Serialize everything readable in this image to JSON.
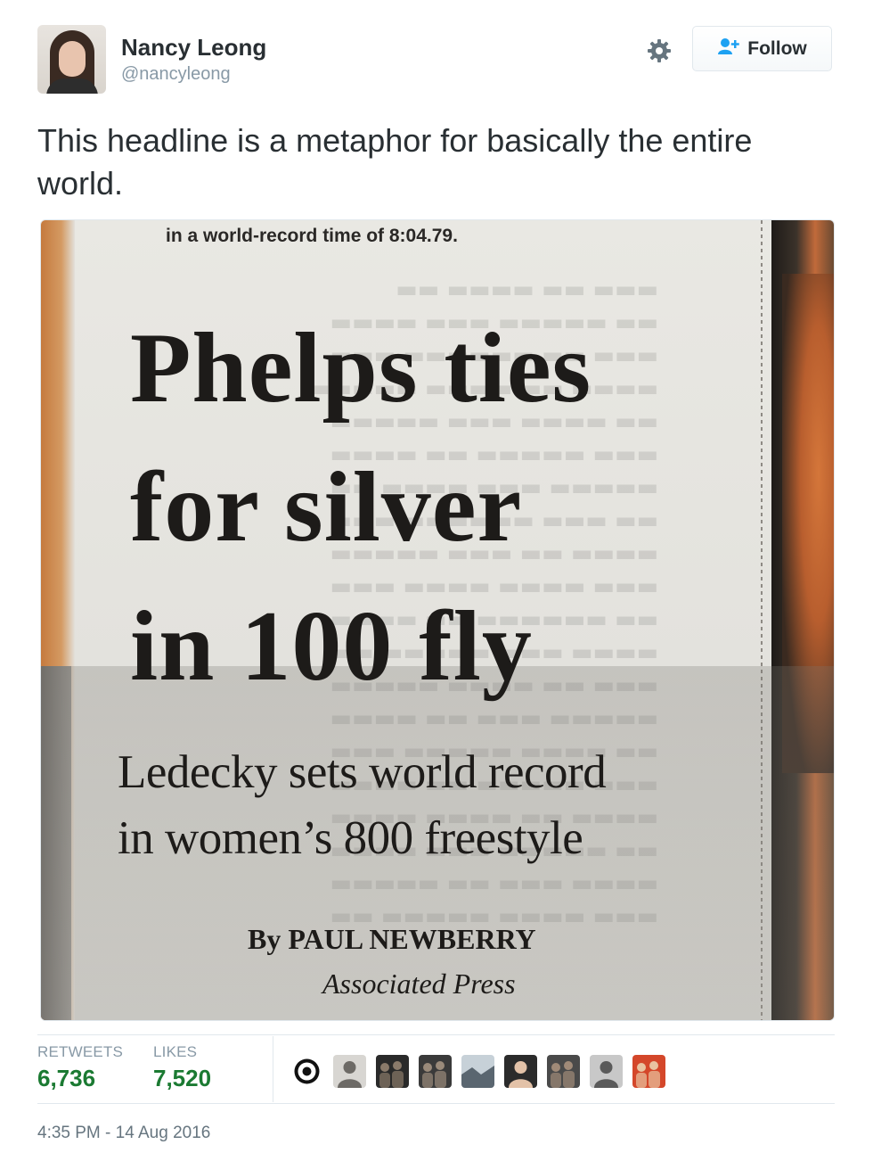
{
  "tweet": {
    "author_name": "Nancy Leong",
    "author_handle": "@nancyleong",
    "follow_label": "Follow",
    "text": "This headline is a metaphor for basically the entire world.",
    "timestamp": "4:35 PM - 14 Aug 2016"
  },
  "media": {
    "top_line": "in a world-record time of 8:04.79.",
    "headline_lines": [
      "Phelps ties",
      "for silver",
      "in 100 fly"
    ],
    "subhead_lines": [
      "Ledecky sets world record",
      "in women’s 800 freestyle"
    ],
    "byline": "By PAUL NEWBERRY",
    "agency": "Associated Press"
  },
  "stats": {
    "retweets_label": "RETWEETS",
    "retweets_value": "6,736",
    "likes_label": "LIKES",
    "likes_value": "7,520"
  },
  "likers": [
    {
      "icon": "eye-logo-avatar",
      "colors": [
        "#ffffff",
        "#111111"
      ]
    },
    {
      "icon": "person-avatar",
      "colors": [
        "#d8d6d2",
        "#6d6a66"
      ]
    },
    {
      "icon": "group-photo-avatar",
      "colors": [
        "#2a2a2a",
        "#8a7a6a"
      ]
    },
    {
      "icon": "group-photo-avatar",
      "colors": [
        "#3a3a3a",
        "#9a8a7a"
      ]
    },
    {
      "icon": "landscape-avatar",
      "colors": [
        "#c7d1d8",
        "#5a6670"
      ]
    },
    {
      "icon": "person-avatar",
      "colors": [
        "#2b2b2b",
        "#e3c2a8"
      ]
    },
    {
      "icon": "crowd-avatar",
      "colors": [
        "#4a4a4a",
        "#a08a78"
      ]
    },
    {
      "icon": "person-avatar",
      "colors": [
        "#c8c8c8",
        "#5a5a5a"
      ]
    },
    {
      "icon": "group-photo-avatar",
      "colors": [
        "#d4472a",
        "#e9c3a0"
      ]
    }
  ],
  "colors": {
    "text": "#292f33",
    "muted": "#8899a6",
    "stat_value": "#1b7a32",
    "border": "#e1e8ed"
  }
}
